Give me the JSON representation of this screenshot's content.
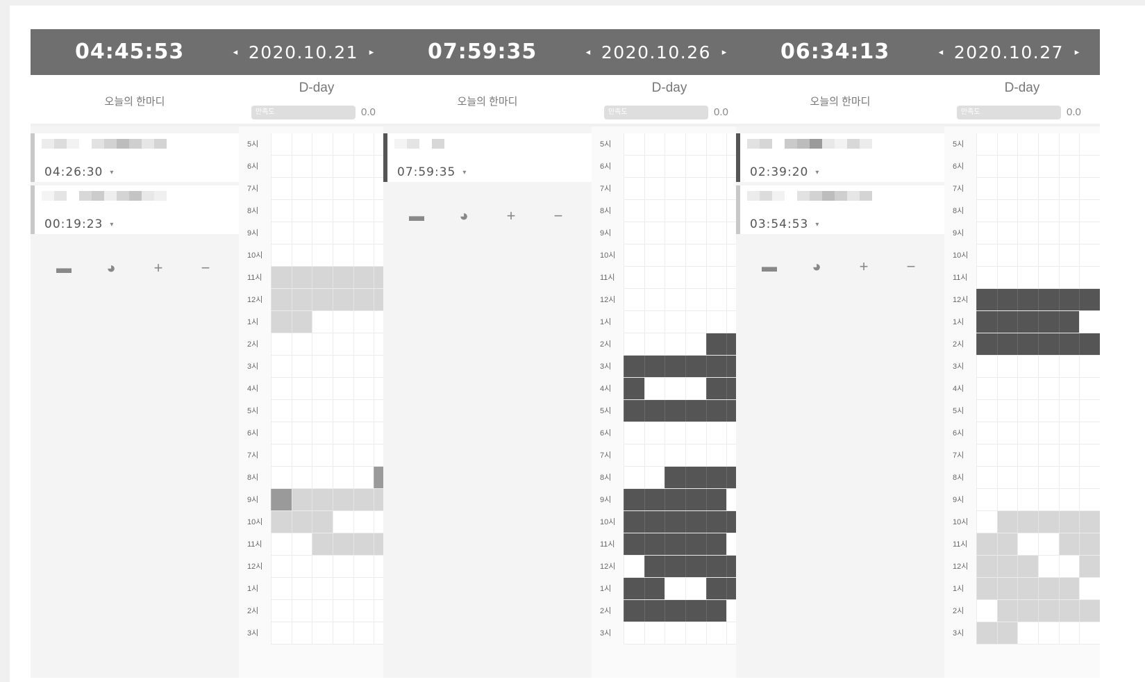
{
  "labels": {
    "comment": "오늘의 한마디",
    "dday": "D-day",
    "satisfaction": "만족도",
    "satisfaction_value": "0.0"
  },
  "colors": {
    "header": "#6f6f6f",
    "light": "#d6d6d6",
    "dark": "#555555"
  },
  "icons": [
    "comment-icon",
    "palette-icon",
    "plus-icon",
    "minus-icon"
  ],
  "hours": [
    "5시",
    "6시",
    "7시",
    "8시",
    "9시",
    "10시",
    "11시",
    "12시",
    "1시",
    "2시",
    "3시",
    "4시",
    "5시",
    "6시",
    "7시",
    "8시",
    "9시",
    "10시",
    "11시",
    "12시",
    "1시",
    "2시",
    "3시"
  ],
  "panels": [
    {
      "clock": "04:45:53",
      "date": "2020.10.21",
      "tasks": [
        {
          "time": "04:26:30",
          "dark": false
        },
        {
          "time": "00:19:23",
          "dark": false
        }
      ],
      "rows": [
        "000000",
        "000000",
        "000000",
        "000000",
        "000000",
        "000000",
        "LLLLLL",
        "LLLLLL",
        "LL0000",
        "000000",
        "000000",
        "000000",
        "000000",
        "000000",
        "000000",
        "00000M",
        "MLLLLL",
        "LLL000",
        "00LLLL",
        "000000",
        "000000",
        "000000",
        "000000"
      ]
    },
    {
      "clock": "07:59:35",
      "date": "2020.10.26",
      "tasks": [
        {
          "time": "07:59:35",
          "dark": true
        }
      ],
      "rows": [
        "000000",
        "000000",
        "000000",
        "000000",
        "000000",
        "000000",
        "000000",
        "000000",
        "000000",
        "0000DD",
        "DDDDDD",
        "D000DD",
        "DDDDDD",
        "000000",
        "000000",
        "00DDDD",
        "DDDDD0",
        "DDDDDD",
        "DDDDD0",
        "0DDDDD",
        "DD00DD",
        "DDDDD0",
        "000000"
      ]
    },
    {
      "clock": "06:34:13",
      "date": "2020.10.27",
      "tasks": [
        {
          "time": "02:39:20",
          "dark": true
        },
        {
          "time": "03:54:53",
          "dark": false
        }
      ],
      "rows": [
        "000000",
        "000000",
        "000000",
        "000000",
        "000000",
        "000000",
        "000000",
        "DDDDDD",
        "DDDDD0",
        "DDDDDD",
        "000000",
        "000000",
        "000000",
        "000000",
        "000000",
        "000000",
        "000000",
        "0LLLLL",
        "LL00LL",
        "LLL00L",
        "LLLLL0",
        "0LLLLL",
        "LL0000"
      ]
    }
  ]
}
